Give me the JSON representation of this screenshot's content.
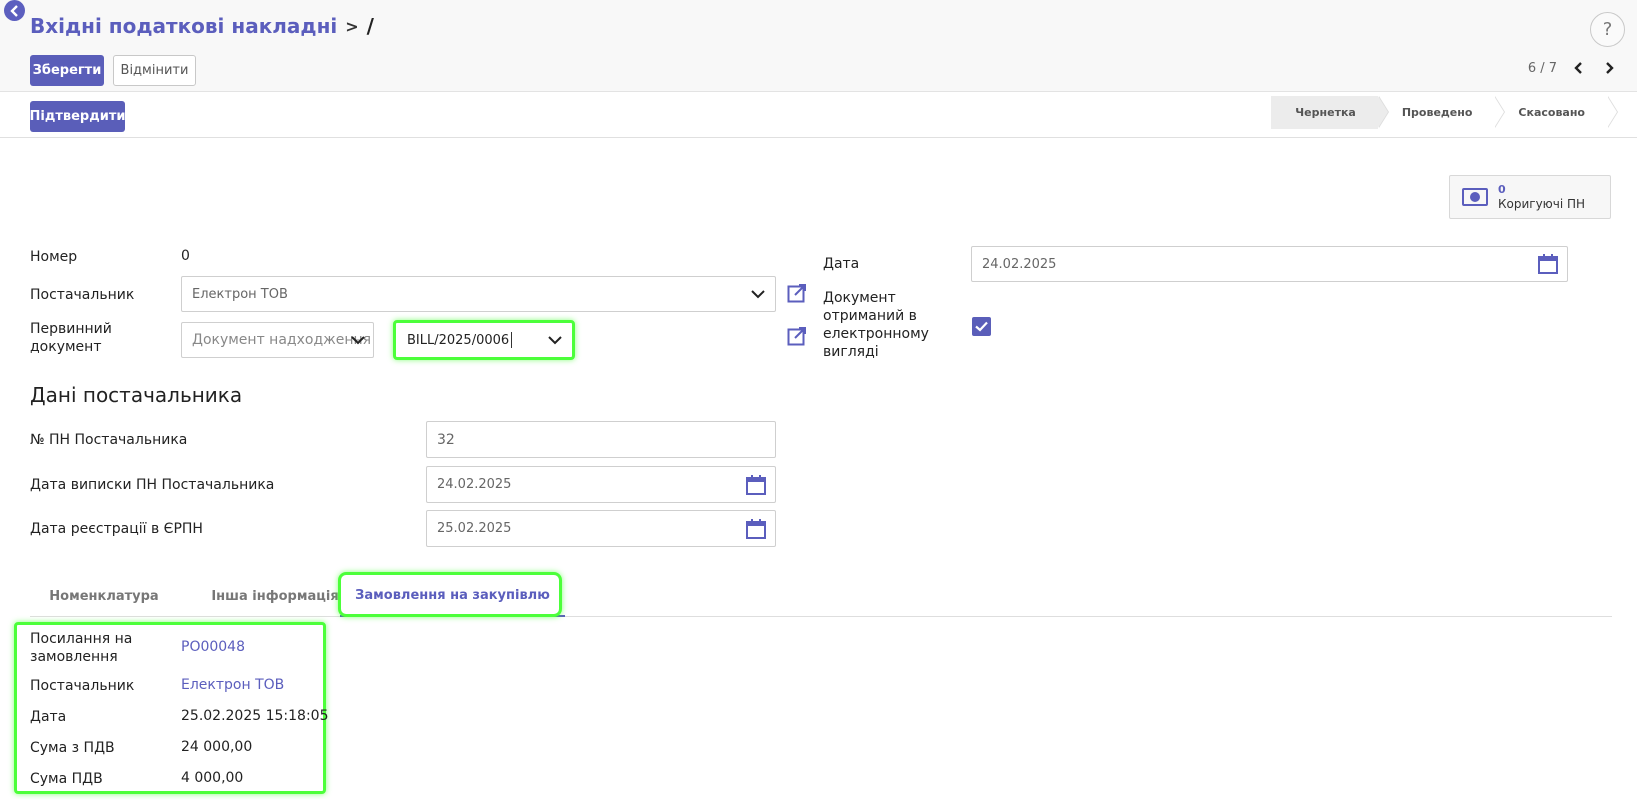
{
  "header": {
    "breadcrumb_parent": "Вхідні податкові накладні",
    "breadcrumb_sep": ">",
    "breadcrumb_current": "/",
    "help_label": "?",
    "save_label": "Зберегти",
    "discard_label": "Відмінити",
    "pager_text": "6 / 7"
  },
  "statusbar": {
    "confirm_label": "Підтвердити",
    "stages": [
      {
        "label": "Чернетка",
        "active": true
      },
      {
        "label": "Проведено",
        "active": false
      },
      {
        "label": "Скасовано",
        "active": false
      }
    ]
  },
  "smart_button": {
    "count": "0",
    "label": "Коригуючі ПН"
  },
  "form": {
    "number_label": "Номер",
    "number_value": "0",
    "supplier_label": "Постачальник",
    "supplier_value": "Електрон ТОВ",
    "primary_doc_label": "Первинний документ",
    "primary_doc_type_placeholder": "Документ надходження",
    "primary_doc_value": "BILL/2025/0006",
    "date_label": "Дата",
    "date_value": "24.02.2025",
    "electronic_label": "Документ отриманий в електронному вигляді",
    "electronic_checked": true
  },
  "supplier_section": {
    "title": "Дані постачальника",
    "tax_number_label": "№ ПН Постачальника",
    "tax_number_value": "32",
    "issue_date_label": "Дата виписки ПН Постачальника",
    "issue_date_value": "24.02.2025",
    "registration_date_label": "Дата реєстрації в ЄРПН",
    "registration_date_value": "25.02.2025"
  },
  "tabs": [
    {
      "label": "Номенклатура",
      "active": false
    },
    {
      "label": "Інша інформація",
      "active": false
    },
    {
      "label": "Замовлення на закупівлю",
      "active": true
    }
  ],
  "purchase_order": {
    "ref_label": "Посилання на замовлення",
    "ref_value": "PO00048",
    "supplier_label": "Постачальник",
    "supplier_value": "Електрон ТОВ",
    "date_label": "Дата",
    "date_value": "25.02.2025 15:18:05",
    "total_label": "Сума з ПДВ",
    "total_value": "24 000,00",
    "vat_label": "Сума ПДВ",
    "vat_value": "4 000,00"
  },
  "colors": {
    "primary": "#5a5eb9",
    "link": "#5b5ebd",
    "highlight": "#4cff3a"
  }
}
